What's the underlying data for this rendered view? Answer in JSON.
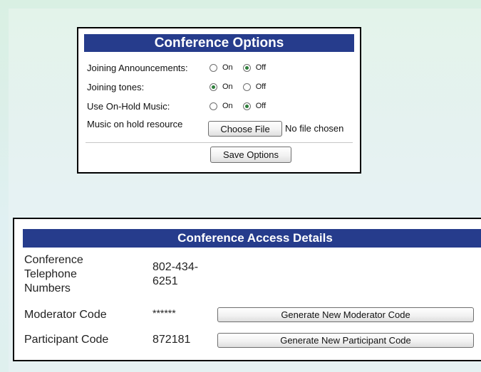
{
  "conference_options": {
    "title": "Conference Options",
    "rows": [
      {
        "label": "Joining Announcements:",
        "on_label": "On",
        "off_label": "Off",
        "selected": "off"
      },
      {
        "label": "Joining tones:",
        "on_label": "On",
        "off_label": "Off",
        "selected": "on"
      },
      {
        "label": "Use On-Hold Music:",
        "on_label": "On",
        "off_label": "Off",
        "selected": "off"
      }
    ],
    "music_resource": {
      "label": "Music on hold resource",
      "choose_file_label": "Choose File",
      "file_status": "No file chosen"
    },
    "save_label": "Save Options"
  },
  "access_details": {
    "title": "Conference Access Details",
    "telephone": {
      "label_line1": "Conference",
      "label_line2": "Telephone",
      "label_line3": "Numbers",
      "value_line1": "802-434-",
      "value_line2": "6251"
    },
    "moderator": {
      "label": "Moderator Code",
      "value": "******",
      "button_label": "Generate New Moderator Code"
    },
    "participant": {
      "label": "Participant Code",
      "value": "872181",
      "button_label": "Generate New Participant Code"
    }
  }
}
